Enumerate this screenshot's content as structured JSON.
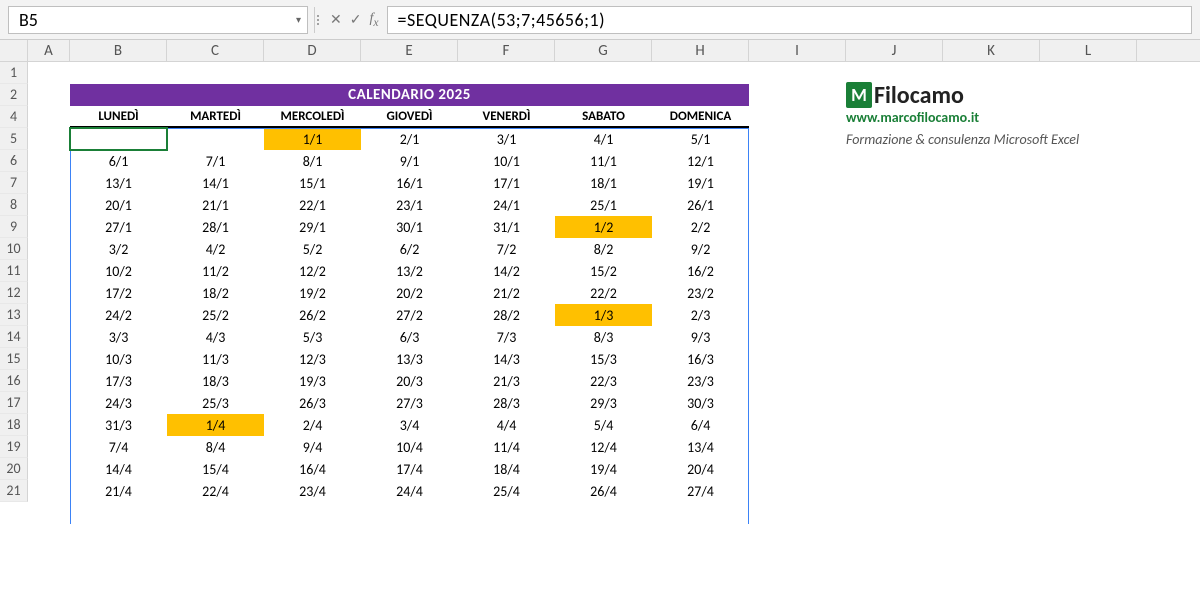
{
  "nameBox": "B5",
  "formula": "=SEQUENZA(53;7;45656;1)",
  "columns": [
    "A",
    "B",
    "C",
    "D",
    "E",
    "F",
    "G",
    "H",
    "I",
    "J",
    "K",
    "L"
  ],
  "rowNumbers": [
    1,
    2,
    4,
    5,
    6,
    7,
    8,
    9,
    10,
    11,
    12,
    13,
    14,
    15,
    16,
    17,
    18,
    19,
    20,
    21
  ],
  "title": "CALENDARIO 2025",
  "dayHeaders": [
    "LUNEDÌ",
    "MARTEDÌ",
    "MERCOLEDÌ",
    "GIOVEDÌ",
    "VENERDÌ",
    "SABATO",
    "DOMENICA"
  ],
  "calendar": [
    [
      "",
      "",
      "1/1",
      "2/1",
      "3/1",
      "4/1",
      "5/1"
    ],
    [
      "6/1",
      "7/1",
      "8/1",
      "9/1",
      "10/1",
      "11/1",
      "12/1"
    ],
    [
      "13/1",
      "14/1",
      "15/1",
      "16/1",
      "17/1",
      "18/1",
      "19/1"
    ],
    [
      "20/1",
      "21/1",
      "22/1",
      "23/1",
      "24/1",
      "25/1",
      "26/1"
    ],
    [
      "27/1",
      "28/1",
      "29/1",
      "30/1",
      "31/1",
      "1/2",
      "2/2"
    ],
    [
      "3/2",
      "4/2",
      "5/2",
      "6/2",
      "7/2",
      "8/2",
      "9/2"
    ],
    [
      "10/2",
      "11/2",
      "12/2",
      "13/2",
      "14/2",
      "15/2",
      "16/2"
    ],
    [
      "17/2",
      "18/2",
      "19/2",
      "20/2",
      "21/2",
      "22/2",
      "23/2"
    ],
    [
      "24/2",
      "25/2",
      "26/2",
      "27/2",
      "28/2",
      "1/3",
      "2/3"
    ],
    [
      "3/3",
      "4/3",
      "5/3",
      "6/3",
      "7/3",
      "8/3",
      "9/3"
    ],
    [
      "10/3",
      "11/3",
      "12/3",
      "13/3",
      "14/3",
      "15/3",
      "16/3"
    ],
    [
      "17/3",
      "18/3",
      "19/3",
      "20/3",
      "21/3",
      "22/3",
      "23/3"
    ],
    [
      "24/3",
      "25/3",
      "26/3",
      "27/3",
      "28/3",
      "29/3",
      "30/3"
    ],
    [
      "31/3",
      "1/4",
      "2/4",
      "3/4",
      "4/4",
      "5/4",
      "6/4"
    ],
    [
      "7/4",
      "8/4",
      "9/4",
      "10/4",
      "11/4",
      "12/4",
      "13/4"
    ],
    [
      "14/4",
      "15/4",
      "16/4",
      "17/4",
      "18/4",
      "19/4",
      "20/4"
    ],
    [
      "21/4",
      "22/4",
      "23/4",
      "24/4",
      "25/4",
      "26/4",
      "27/4"
    ]
  ],
  "highlights": [
    {
      "row": 0,
      "col": 2
    },
    {
      "row": 4,
      "col": 5
    },
    {
      "row": 8,
      "col": 5
    },
    {
      "row": 13,
      "col": 1
    }
  ],
  "brand": {
    "logoLetter": "M",
    "logoText": "Filocamo",
    "url": "www.marcofilocamo.it",
    "tagline": "Formazione & consulenza Microsoft Excel"
  }
}
